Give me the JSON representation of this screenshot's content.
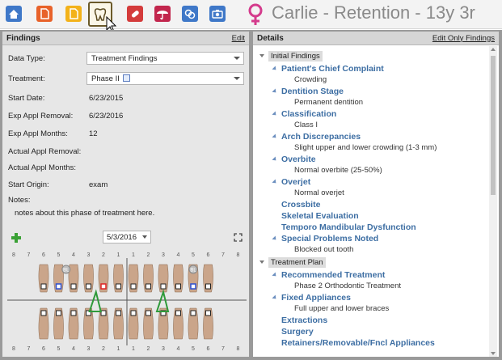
{
  "toolbar": {
    "title": "Carlie - Retention - 13y 3r",
    "buttons": [
      {
        "icon": "home-icon",
        "color": "#3f78c8"
      },
      {
        "icon": "document-icon",
        "color": "#e8622a"
      },
      {
        "icon": "folder-icon",
        "color": "#f3b21a"
      },
      {
        "icon": "tooth-icon",
        "color": "#6b5a2a"
      },
      {
        "icon": "pills-icon",
        "color": "#d43b3b"
      },
      {
        "icon": "umbrella-icon",
        "color": "#c2264d"
      },
      {
        "icon": "link-icon",
        "color": "#3f78c8"
      },
      {
        "icon": "camera-icon",
        "color": "#3f78c8"
      }
    ],
    "gender_color": "#d43b8c"
  },
  "findings": {
    "title": "Findings",
    "edit": "Edit",
    "fields": [
      {
        "label": "Data Type:",
        "value": "Treatment Findings"
      },
      {
        "label": "Treatment:",
        "value": "Phase II"
      },
      {
        "label": "Start Date:",
        "value": "6/23/2015"
      },
      {
        "label": "Exp Appl Removal:",
        "value": "6/23/2016"
      },
      {
        "label": "Exp Appl Months:",
        "value": "12"
      },
      {
        "label": "Actual Appl Removal:",
        "value": ""
      },
      {
        "label": "Actual Appl Months:",
        "value": ""
      },
      {
        "label": "Start Origin:",
        "value": "exam"
      }
    ],
    "notes_label": "Notes:",
    "notes": "notes about this phase of treatment here.",
    "chart_date": "5/3/2016",
    "tooth_numbers_top": [
      "8",
      "7",
      "6",
      "5",
      "4",
      "3",
      "2",
      "1",
      "1",
      "2",
      "3",
      "4",
      "5",
      "6",
      "7",
      "8"
    ],
    "tooth_numbers_bottom": [
      "8",
      "7",
      "6",
      "5",
      "4",
      "3",
      "2",
      "1",
      "1",
      "2",
      "3",
      "4",
      "5",
      "6",
      "7",
      "8"
    ],
    "badge": "BL"
  },
  "details": {
    "title": "Details",
    "edit": "Edit Only Findings",
    "sections": [
      {
        "label": "Initial Findings",
        "items": [
          {
            "label": "Patient's Chief Complaint",
            "value": "Crowding"
          },
          {
            "label": "Dentition Stage",
            "value": "Permanent dentition"
          },
          {
            "label": "Classification",
            "value": "Class I"
          },
          {
            "label": "Arch Discrepancies",
            "value": "Slight upper and lower crowding (1-3 mm)"
          },
          {
            "label": "Overbite",
            "value": "Normal overbite (25-50%)"
          },
          {
            "label": "Overjet",
            "value": "Normal overjet"
          },
          {
            "label": "Crossbite",
            "value": ""
          },
          {
            "label": "Skeletal Evaluation",
            "value": ""
          },
          {
            "label": "Temporo Mandibular Dysfunction",
            "value": ""
          },
          {
            "label": "Special Problems Noted",
            "value": "Blocked out tooth"
          }
        ]
      },
      {
        "label": "Treatment Plan",
        "items": [
          {
            "label": "Recommended Treatment",
            "value": "Phase 2 Orthodontic Treatment"
          },
          {
            "label": "Fixed Appliances",
            "value": "Full upper and lower braces"
          },
          {
            "label": "Extractions",
            "value": ""
          },
          {
            "label": "Surgery",
            "value": ""
          },
          {
            "label": "Retainers/Removable/Fncl Appliances",
            "value": ""
          }
        ]
      }
    ]
  }
}
